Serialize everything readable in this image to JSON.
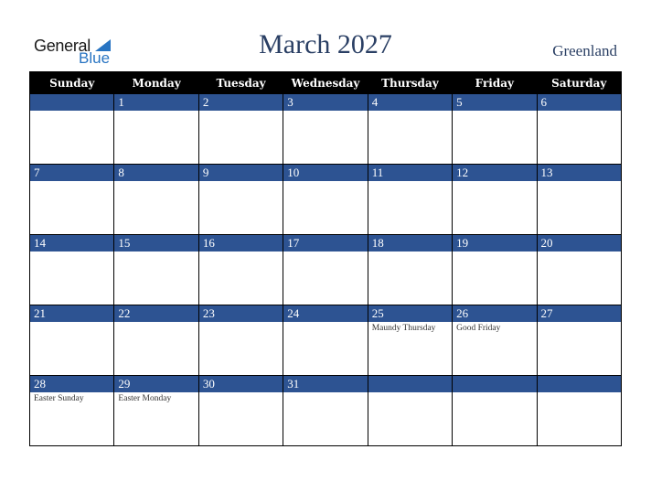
{
  "logo": {
    "word1": "General",
    "word2": "Blue"
  },
  "header": {
    "title": "March 2027",
    "country": "Greenland"
  },
  "colors": {
    "accent": "#2d5392",
    "header_bg": "#000000",
    "title": "#2a3f64",
    "logo_blue": "#2874c2"
  },
  "weekdays": [
    "Sunday",
    "Monday",
    "Tuesday",
    "Wednesday",
    "Thursday",
    "Friday",
    "Saturday"
  ],
  "weeks": [
    [
      {
        "day": "",
        "holiday": ""
      },
      {
        "day": "1",
        "holiday": ""
      },
      {
        "day": "2",
        "holiday": ""
      },
      {
        "day": "3",
        "holiday": ""
      },
      {
        "day": "4",
        "holiday": ""
      },
      {
        "day": "5",
        "holiday": ""
      },
      {
        "day": "6",
        "holiday": ""
      }
    ],
    [
      {
        "day": "7",
        "holiday": ""
      },
      {
        "day": "8",
        "holiday": ""
      },
      {
        "day": "9",
        "holiday": ""
      },
      {
        "day": "10",
        "holiday": ""
      },
      {
        "day": "11",
        "holiday": ""
      },
      {
        "day": "12",
        "holiday": ""
      },
      {
        "day": "13",
        "holiday": ""
      }
    ],
    [
      {
        "day": "14",
        "holiday": ""
      },
      {
        "day": "15",
        "holiday": ""
      },
      {
        "day": "16",
        "holiday": ""
      },
      {
        "day": "17",
        "holiday": ""
      },
      {
        "day": "18",
        "holiday": ""
      },
      {
        "day": "19",
        "holiday": ""
      },
      {
        "day": "20",
        "holiday": ""
      }
    ],
    [
      {
        "day": "21",
        "holiday": ""
      },
      {
        "day": "22",
        "holiday": ""
      },
      {
        "day": "23",
        "holiday": ""
      },
      {
        "day": "24",
        "holiday": ""
      },
      {
        "day": "25",
        "holiday": "Maundy Thursday"
      },
      {
        "day": "26",
        "holiday": "Good Friday"
      },
      {
        "day": "27",
        "holiday": ""
      }
    ],
    [
      {
        "day": "28",
        "holiday": "Easter Sunday"
      },
      {
        "day": "29",
        "holiday": "Easter Monday"
      },
      {
        "day": "30",
        "holiday": ""
      },
      {
        "day": "31",
        "holiday": ""
      },
      {
        "day": "",
        "holiday": ""
      },
      {
        "day": "",
        "holiday": ""
      },
      {
        "day": "",
        "holiday": ""
      }
    ]
  ]
}
